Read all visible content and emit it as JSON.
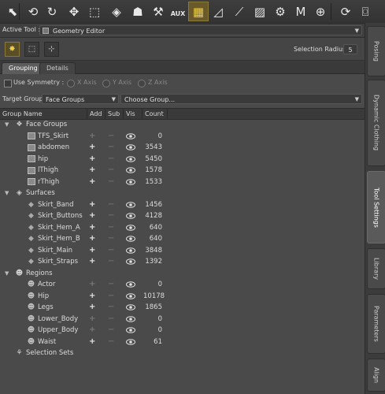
{
  "toolbar": {
    "tools": [
      {
        "icon": "pointer-icon",
        "glyph": "⬉",
        "active": false
      },
      {
        "icon": "universal-rotate-icon",
        "glyph": "⟲",
        "active": false
      },
      {
        "icon": "rotate-icon",
        "glyph": "↻",
        "active": false
      },
      {
        "icon": "translate-icon",
        "glyph": "✥",
        "active": false
      },
      {
        "icon": "scale-icon",
        "glyph": "⬚",
        "active": false
      },
      {
        "icon": "surface-selection-icon",
        "glyph": "◈",
        "active": false
      },
      {
        "icon": "figure-pose-icon",
        "glyph": "☗",
        "active": false
      },
      {
        "icon": "joint-editor-icon",
        "glyph": "⚒",
        "active": false
      },
      {
        "icon": "aux-viewport-icon",
        "glyph": "AUX",
        "active": false
      },
      {
        "icon": "geometry-editor-icon",
        "glyph": "▦",
        "active": true
      },
      {
        "icon": "spot-render-icon",
        "glyph": "◿",
        "active": false
      },
      {
        "icon": "node-weight-icon",
        "glyph": "⟋",
        "active": false
      },
      {
        "icon": "weight-brush-icon",
        "glyph": "▨",
        "active": false
      },
      {
        "icon": "tool-icon",
        "glyph": "⚙",
        "active": false
      },
      {
        "icon": "morph-brush-icon",
        "glyph": "M",
        "active": false
      },
      {
        "icon": "navigate-icon",
        "glyph": "⊕",
        "active": false
      },
      {
        "icon": "camera-orbit-icon",
        "glyph": "⟳",
        "active": false
      },
      {
        "icon": "camera-icon",
        "glyph": "⌼",
        "active": false
      }
    ]
  },
  "active_tool": {
    "label": "Active Tool :",
    "value": "Geometry Editor"
  },
  "selection_radius": {
    "label": "Selection Radius :",
    "value": "5"
  },
  "tabs": [
    "Grouping",
    "Details"
  ],
  "symmetry": {
    "label": "Use Symmetry :",
    "axes": [
      "X Axis",
      "Y Axis",
      "Z Axis"
    ]
  },
  "target_group": {
    "label": "Target Group :",
    "value": "Face Groups",
    "choose": "Choose Group..."
  },
  "columns": [
    "Group Name",
    "Add",
    "Sub",
    "Vis",
    "Count"
  ],
  "side_tabs": [
    "Posing",
    "Dynamic Clothing",
    "Tool Settings",
    "Library",
    "Parameters",
    "Align"
  ],
  "side_tabs_active": "Tool Settings",
  "groups": [
    {
      "name": "Face Groups",
      "type": "category",
      "icon": "face-groups-icon",
      "level": 0
    },
    {
      "name": "TFS_Skirt",
      "type": "face",
      "add": "dim",
      "count": "0",
      "level": 1
    },
    {
      "name": "abdomen",
      "type": "face",
      "add": "on",
      "count": "3543",
      "level": 1
    },
    {
      "name": "hip",
      "type": "face",
      "add": "on",
      "count": "5450",
      "level": 1
    },
    {
      "name": "lThigh",
      "type": "face",
      "add": "on",
      "count": "1578",
      "level": 1
    },
    {
      "name": "rThigh",
      "type": "face",
      "add": "on",
      "count": "1533",
      "level": 1
    },
    {
      "name": "Surfaces",
      "type": "category",
      "icon": "surfaces-icon",
      "level": 0
    },
    {
      "name": "Skirt_Band",
      "type": "surface",
      "add": "on",
      "count": "1456",
      "level": 1
    },
    {
      "name": "Skirt_Buttons",
      "type": "surface",
      "add": "on",
      "count": "4128",
      "level": 1
    },
    {
      "name": "Skirt_Hem_A",
      "type": "surface",
      "add": "on",
      "count": "640",
      "level": 1
    },
    {
      "name": "Skirt_Hem_B",
      "type": "surface",
      "add": "on",
      "count": "640",
      "level": 1
    },
    {
      "name": "Skirt_Main",
      "type": "surface",
      "add": "on",
      "count": "3848",
      "level": 1
    },
    {
      "name": "Skirt_Straps",
      "type": "surface",
      "add": "on",
      "count": "1392",
      "level": 1
    },
    {
      "name": "Regions",
      "type": "category",
      "icon": "regions-icon",
      "level": 0
    },
    {
      "name": "Actor",
      "type": "region",
      "add": "dim",
      "count": "0",
      "level": 1
    },
    {
      "name": "Hip",
      "type": "region",
      "add": "on",
      "count": "10178",
      "level": 1
    },
    {
      "name": "Legs",
      "type": "region",
      "add": "on",
      "count": "1865",
      "level": 1
    },
    {
      "name": "Lower_Body",
      "type": "region",
      "add": "dim",
      "count": "0",
      "level": 1
    },
    {
      "name": "Upper_Body",
      "type": "region",
      "add": "dim",
      "count": "0",
      "level": 1
    },
    {
      "name": "Waist",
      "type": "region",
      "add": "on",
      "count": "61",
      "level": 1
    },
    {
      "name": "Selection Sets",
      "type": "sets",
      "icon": "selection-sets-icon",
      "level": 0
    }
  ]
}
